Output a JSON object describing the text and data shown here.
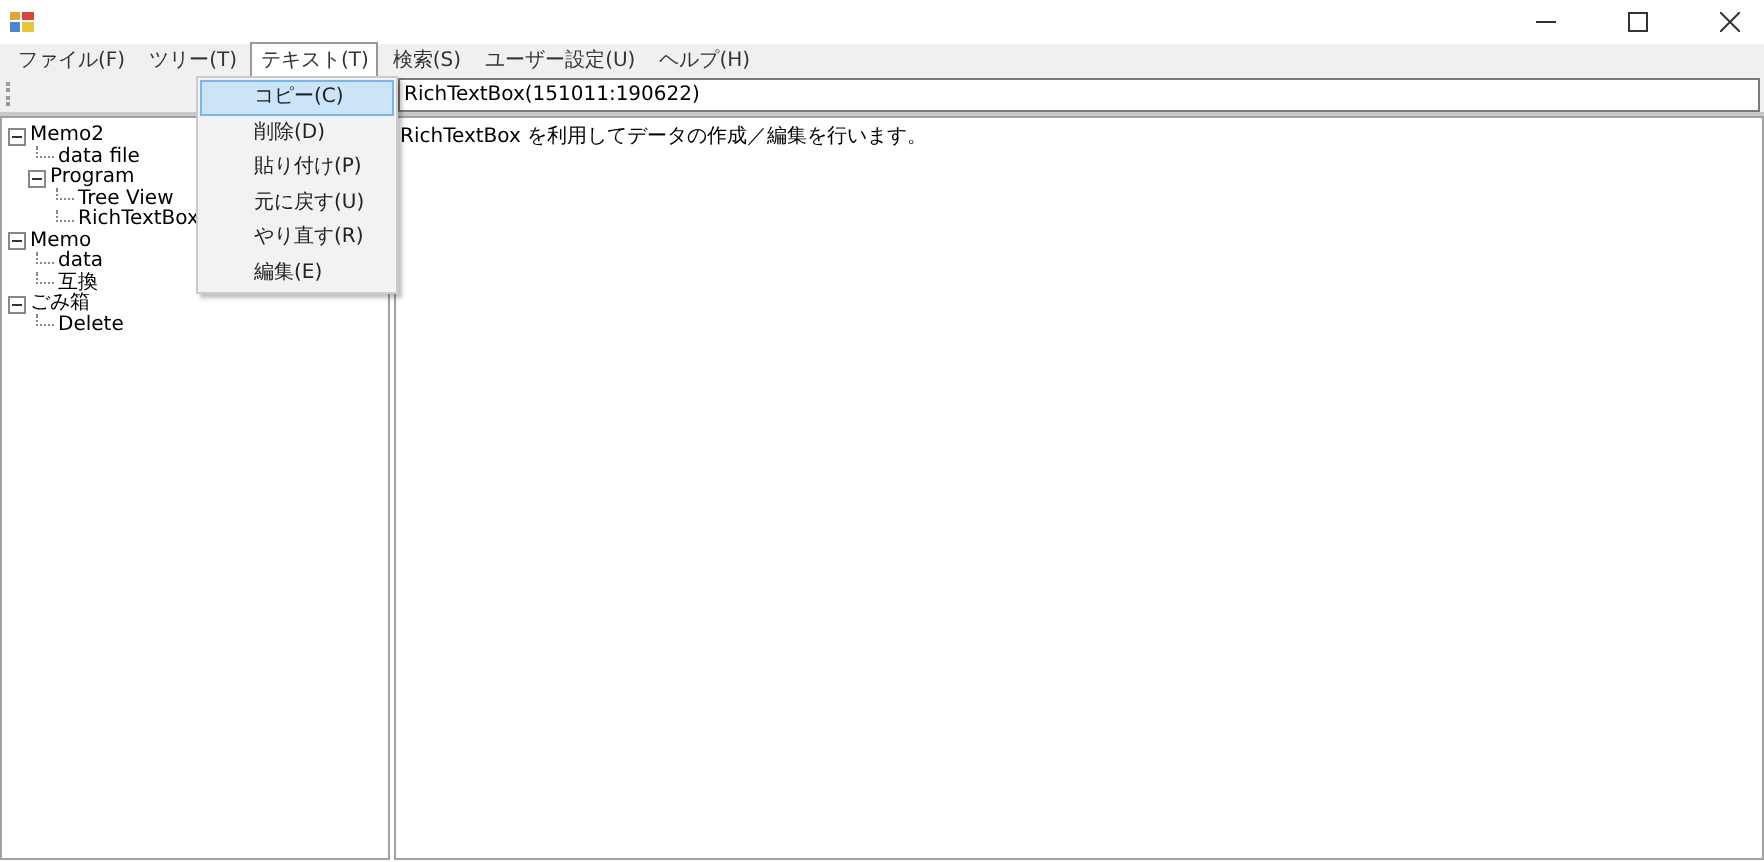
{
  "menu_bar": [
    {
      "label": "ファイル(F)",
      "selected": false
    },
    {
      "label": "ツリー(T)",
      "selected": false
    },
    {
      "label": "テキスト(T)",
      "selected": true
    },
    {
      "label": "検索(S)",
      "selected": false
    },
    {
      "label": "ユーザー設定(U)",
      "selected": false
    },
    {
      "label": "ヘルプ(H)",
      "selected": false
    }
  ],
  "dropdown": [
    {
      "label": "コピー(C)",
      "selected": true
    },
    {
      "label": "削除(D)",
      "selected": false
    },
    {
      "label": "貼り付け(P)",
      "selected": false
    },
    {
      "label": "元に戻す(U)",
      "selected": false
    },
    {
      "label": "やり直す(R)",
      "selected": false
    },
    {
      "label": "編集(E)",
      "selected": false
    }
  ],
  "path_field": {
    "value": "RichTextBox(151011:190622)"
  },
  "tree": [
    {
      "label": "Memo2",
      "expanded": true,
      "children": [
        {
          "label": "data file"
        },
        {
          "label": "Program",
          "expanded": true,
          "children": [
            {
              "label": "Tree View"
            },
            {
              "label": "RichTextBox"
            }
          ]
        }
      ]
    },
    {
      "label": "Memo",
      "expanded": true,
      "children": [
        {
          "label": "data"
        },
        {
          "label": "互換"
        }
      ]
    },
    {
      "label": "ごみ箱",
      "expanded": true,
      "children": [
        {
          "label": "Delete"
        }
      ]
    }
  ],
  "editor": {
    "text": "RichTextBox を利用してデータの作成／編集を行います。"
  }
}
